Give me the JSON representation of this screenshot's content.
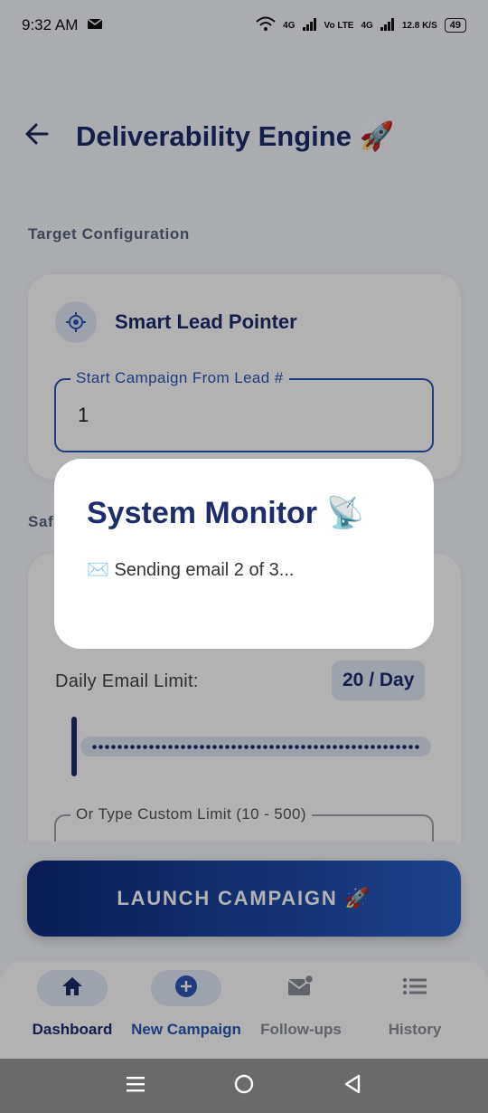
{
  "status": {
    "time": "9:32 AM",
    "signal1": "4G",
    "volte": "Vo LTE",
    "signal2": "4G",
    "speed": "12.8 K/S",
    "battery": "49"
  },
  "header": {
    "title": "Deliverability Engine 🚀"
  },
  "target": {
    "section_label": "Target Configuration",
    "card_title": "Smart Lead Pointer",
    "field_label": "Start Campaign From Lead #",
    "field_value": "1"
  },
  "safety": {
    "section_label": "Saf",
    "limit_label": "Daily Email Limit:",
    "limit_value": "20 / Day",
    "slider_fraction": 0,
    "custom_limit_label": "Or Type Custom Limit (10 - 500)"
  },
  "launch_button": "LAUNCH CAMPAIGN 🚀",
  "nav": [
    {
      "label": "Dashboard"
    },
    {
      "label": "New Campaign"
    },
    {
      "label": "Follow-ups"
    },
    {
      "label": "History"
    }
  ],
  "dialog": {
    "title": "System Monitor 📡",
    "message": "✉️ Sending email 2 of 3..."
  },
  "colors": {
    "primary": "#1d2c6b",
    "accent": "#2b56b5",
    "selected_pill": "#e3e9f7"
  }
}
